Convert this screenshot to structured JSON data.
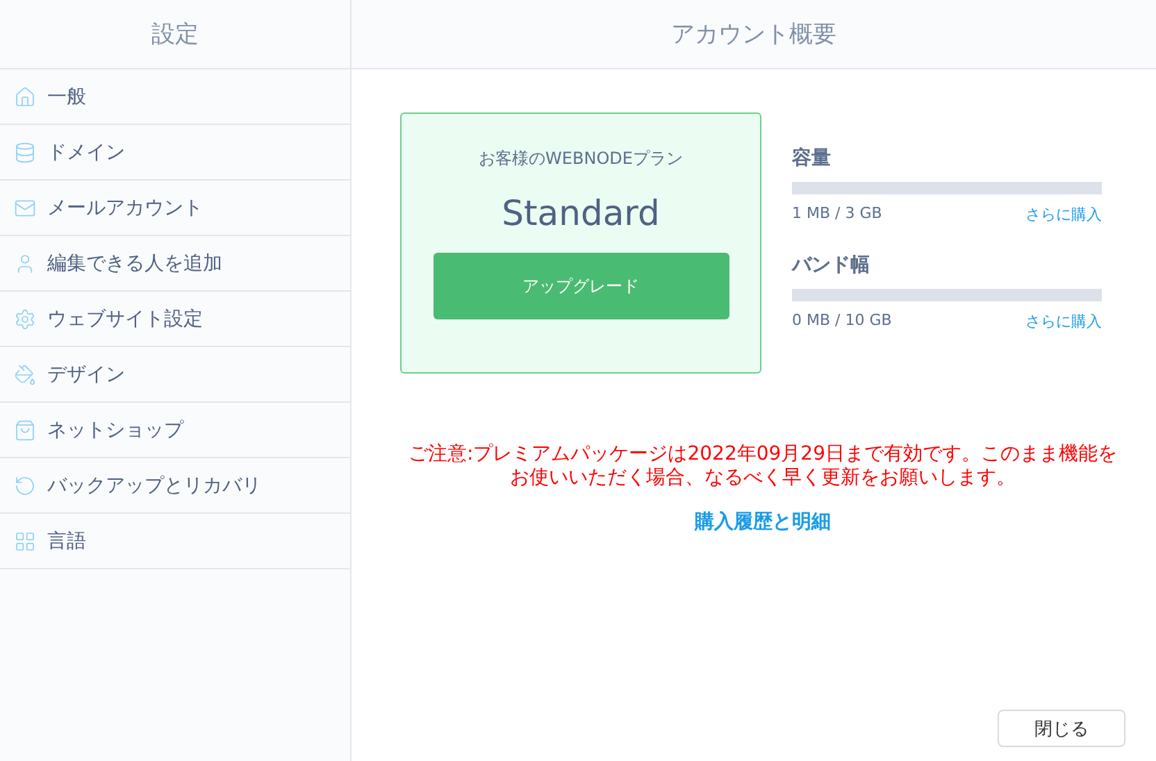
{
  "sidebar": {
    "title": "設定",
    "items": [
      {
        "label": "一般",
        "kind": "home"
      },
      {
        "label": "ドメイン",
        "kind": "database"
      },
      {
        "label": "メールアカウント",
        "kind": "mail"
      },
      {
        "label": "編集できる人を追加",
        "kind": "user"
      },
      {
        "label": "ウェブサイト設定",
        "kind": "gear"
      },
      {
        "label": "デザイン",
        "kind": "paint"
      },
      {
        "label": "ネットショップ",
        "kind": "bag"
      },
      {
        "label": "バックアップとリカバリ",
        "kind": "refresh"
      },
      {
        "label": "言語",
        "kind": "grid"
      }
    ]
  },
  "main": {
    "title": "アカウント概要",
    "plan": {
      "caption": "お客様のWEBNODEプラン",
      "name": "Standard",
      "button": "アップグレード"
    },
    "meters": [
      {
        "label": "容量",
        "reading": "1 MB / 3 GB",
        "link": "さらに購入"
      },
      {
        "label": "バンド幅",
        "reading": "0 MB / 10 GB",
        "link": "さらに購入"
      }
    ],
    "notice": "ご注意:プレミアムパッケージは2022年09月29日まで有効です。このまま機能をお使いいただく場合、なるべく早く更新をお願いします。",
    "history_link": "購入履歴と明細",
    "close_button": "閉じる"
  }
}
